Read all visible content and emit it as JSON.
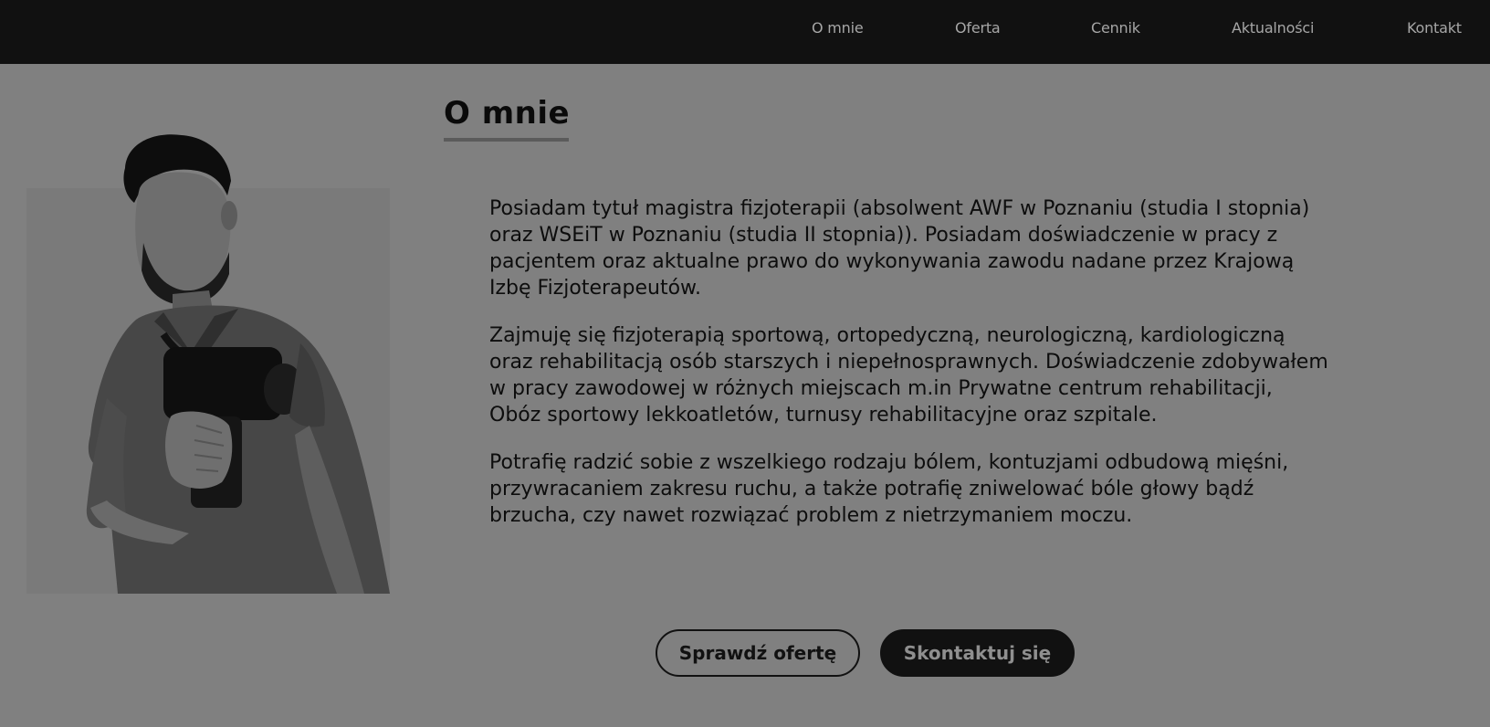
{
  "nav": {
    "items": [
      {
        "label": "O mnie"
      },
      {
        "label": "Oferta"
      },
      {
        "label": "Cennik"
      },
      {
        "label": "Aktualności"
      },
      {
        "label": "Kontakt"
      }
    ]
  },
  "about": {
    "title": "O mnie",
    "paragraphs": [
      "Posiadam tytuł magistra fizjoterapii (absolwent AWF w Poznaniu (studia I stopnia) oraz WSEiT w Poznaniu (studia II stopnia)). Posiadam doświadczenie w pracy z pacjentem oraz aktualne prawo do wykonywania zawodu nadane przez Krajową Izbę Fizjoterapeutów.",
      "Zajmuję się fizjoterapią sportową, ortopedyczną, neurologiczną, kardiologiczną oraz rehabilitacją osób starszych i niepełnosprawnych. Doświadczenie zdobywałem w pracy zawodowej w różnych miejscach m.in Prywatne centrum rehabilitacji, Obóz sportowy lekkoatletów, turnusy rehabilitacyjne oraz szpitale.",
      "Potrafię radzić sobie z wszelkiego rodzaju bólem, kontuzjami odbudową mięśni, przywracaniem zakresu ruchu, a także potrafię zniwelować bóle głowy bądź brzucha, czy nawet rozwiązać problem z nietrzymaniem moczu."
    ]
  },
  "buttons": {
    "offer": "Sprawdź ofertę",
    "contact": "Skontaktuj się"
  },
  "colors": {
    "background": "#808080",
    "topbar": "#111111",
    "nav_text": "#a6a6a6"
  },
  "icons": {
    "photo": "portrait-photo"
  }
}
